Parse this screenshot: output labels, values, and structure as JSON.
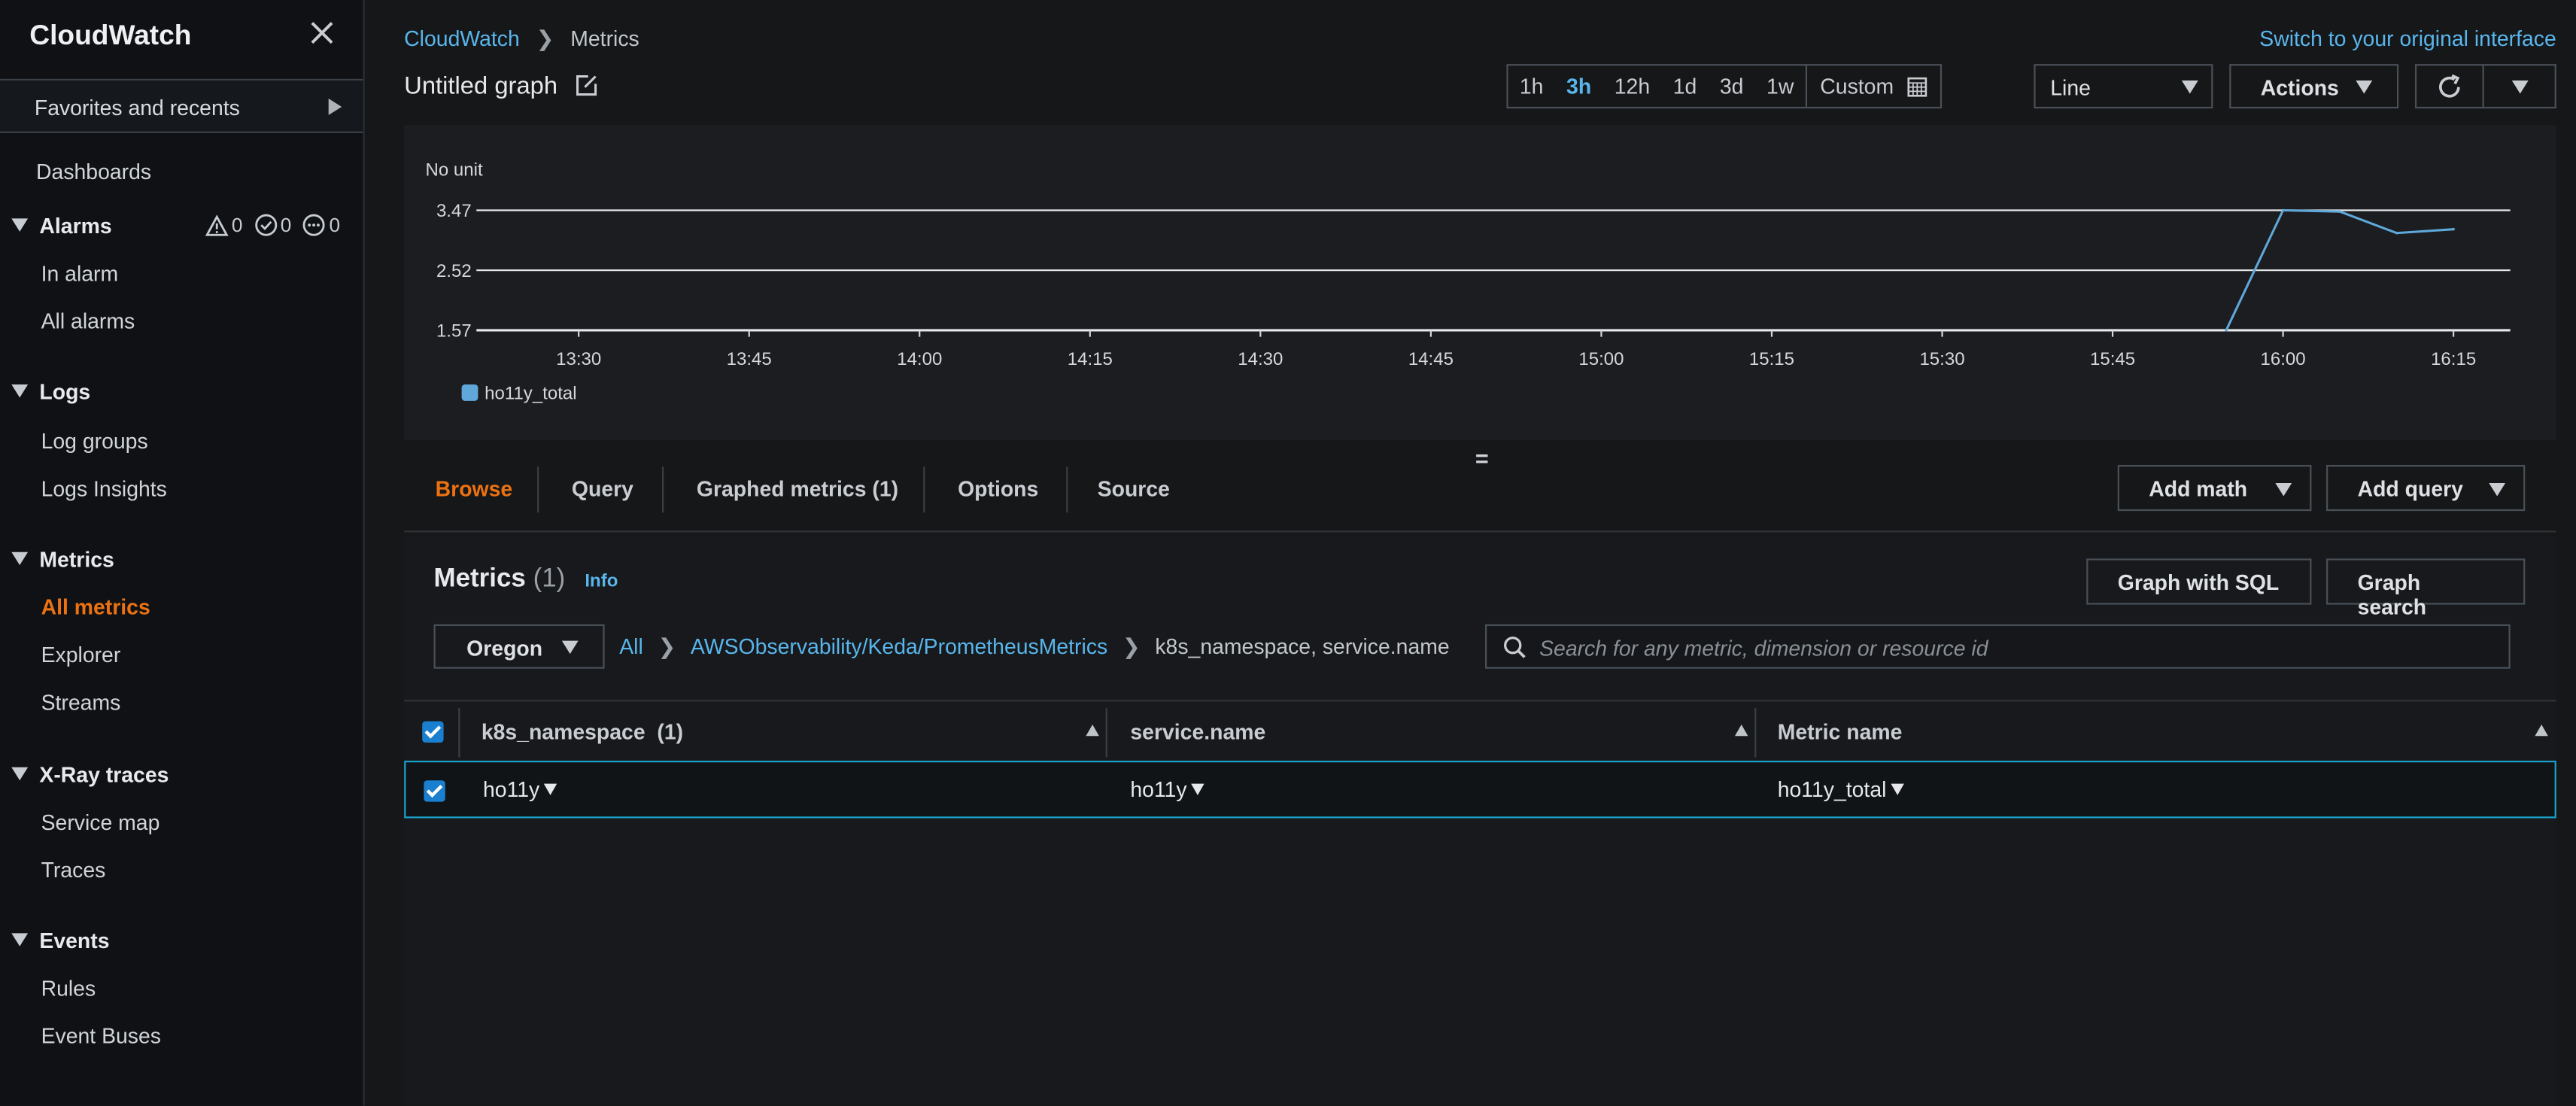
{
  "sidebar": {
    "title": "CloudWatch",
    "favorites": "Favorites and recents",
    "dashboards": "Dashboards",
    "alarms": {
      "label": "Alarms",
      "counts": [
        "0",
        "0",
        "0"
      ],
      "items": [
        "In alarm",
        "All alarms"
      ]
    },
    "logs": {
      "label": "Logs",
      "items": [
        "Log groups",
        "Logs Insights"
      ]
    },
    "metrics": {
      "label": "Metrics",
      "items": [
        "All metrics",
        "Explorer",
        "Streams"
      ]
    },
    "xray": {
      "label": "X-Ray traces",
      "items": [
        "Service map",
        "Traces"
      ]
    },
    "events": {
      "label": "Events",
      "items": [
        "Rules",
        "Event Buses"
      ]
    }
  },
  "header": {
    "breadcrumb": [
      "CloudWatch",
      "Metrics"
    ],
    "switch_link": "Switch to your original interface",
    "graph_title": "Untitled graph",
    "ranges": [
      "1h",
      "3h",
      "12h",
      "1d",
      "3d",
      "1w"
    ],
    "active_range": "3h",
    "custom": "Custom",
    "chart_type": "Line",
    "actions": "Actions"
  },
  "chart_data": {
    "type": "line",
    "ylabel": "No unit",
    "y_ticks": [
      "3.47",
      "2.52",
      "1.57"
    ],
    "ylim": [
      1.57,
      3.47
    ],
    "x_ticks": [
      "13:30",
      "13:45",
      "14:00",
      "14:15",
      "14:30",
      "14:45",
      "15:00",
      "15:15",
      "15:30",
      "15:45",
      "16:00",
      "16:15"
    ],
    "xlim": [
      "13:21",
      "16:20"
    ],
    "series": [
      {
        "name": "ho11y_total",
        "color": "#5fa8d9",
        "x": [
          "15:55",
          "16:00",
          "16:05",
          "16:10",
          "16:15"
        ],
        "values": [
          1.57,
          3.47,
          3.45,
          3.11,
          3.17
        ]
      }
    ],
    "grid": "horizontal"
  },
  "tabs": {
    "items": [
      "Browse",
      "Query",
      "Graphed metrics (1)",
      "Options",
      "Source"
    ],
    "active": "Browse",
    "add_math": "Add math",
    "add_query": "Add query"
  },
  "metrics_panel": {
    "title": "Metrics",
    "count": "(1)",
    "info": "Info",
    "graph_sql": "Graph with SQL",
    "graph_search": "Graph search",
    "region": "Oregon",
    "path": [
      "All",
      "AWSObservability/Keda/PrometheusMetrics",
      "k8s_namespace, service.name"
    ],
    "search_placeholder": "Search for any metric, dimension or resource id",
    "columns": [
      "k8s_namespace",
      "(1)",
      "service.name",
      "Metric name"
    ],
    "rows": [
      {
        "namespace": "ho11y",
        "service": "ho11y",
        "metric": "ho11y_total"
      }
    ]
  }
}
